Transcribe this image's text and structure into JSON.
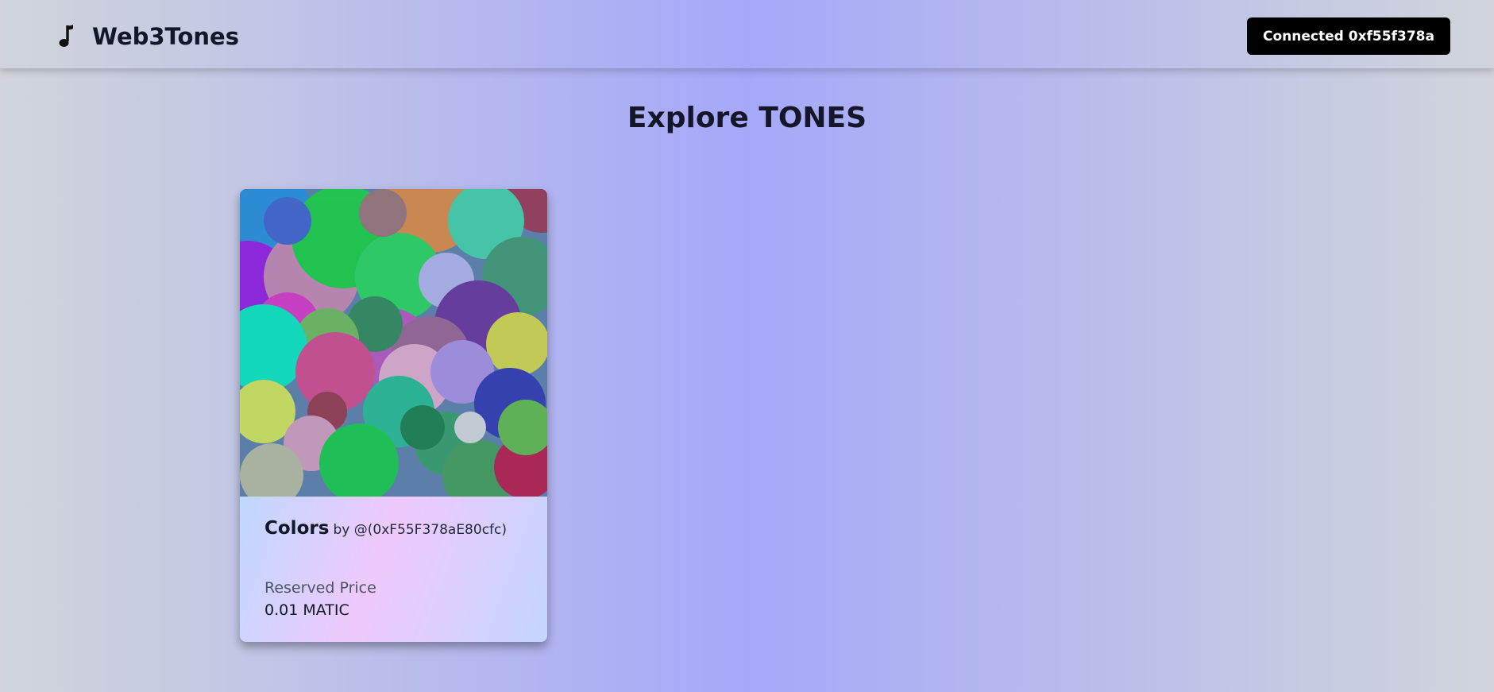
{
  "navbar": {
    "brand_icon": "music-note-icon",
    "brand_name": "Web3Tones",
    "connect_label": "Connected 0xf55f378a"
  },
  "main": {
    "heading": "Explore TONES",
    "cards": [
      {
        "title": "Colors",
        "by": "by @(0xF55F378aE80cfc)",
        "price_label": "Reserved Price",
        "price_value": "0.01 MATIC"
      }
    ]
  },
  "colors": {
    "accent": "#000000",
    "bg_gradient_start": "#d1d5db",
    "bg_gradient_mid": "#a5a8f8"
  }
}
